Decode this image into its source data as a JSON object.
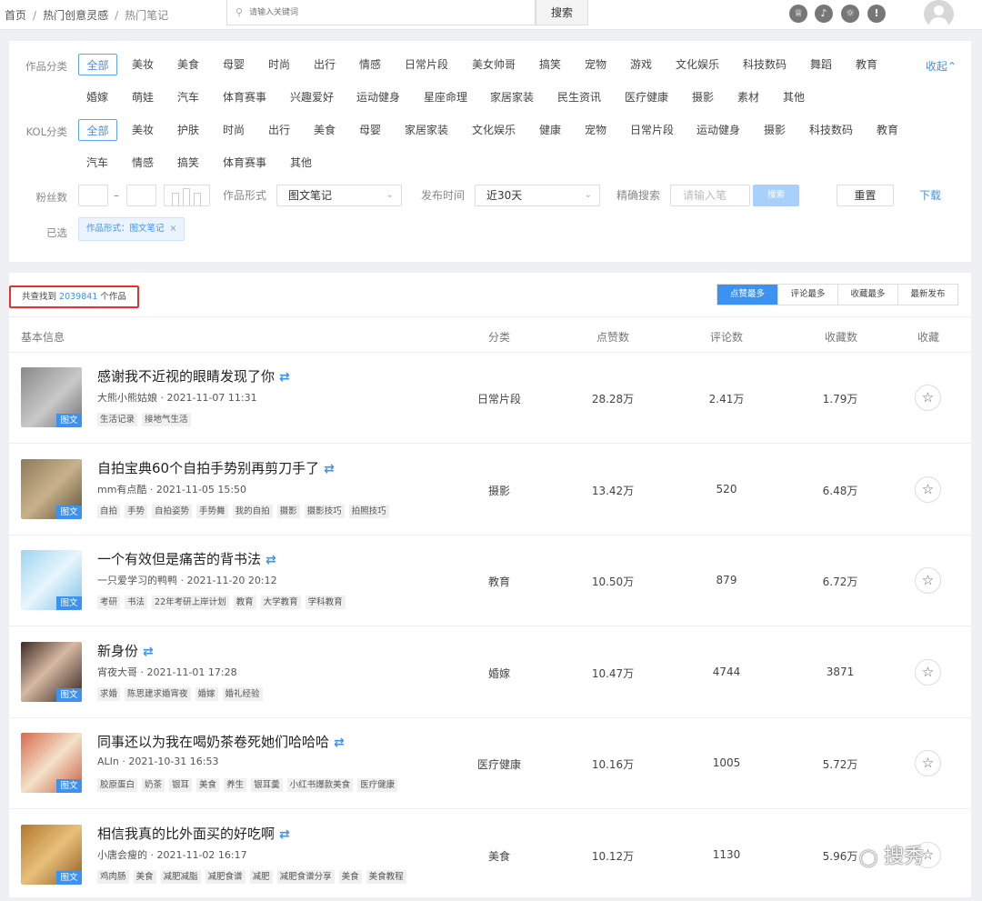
{
  "breadcrumb": {
    "home": "首页",
    "level2": "热门创意灵感",
    "current": "热门笔记"
  },
  "search": {
    "placeholder": "请输入关键词",
    "button": "搜索"
  },
  "filters": {
    "work_category": {
      "label": "作品分类",
      "row1": [
        "全部",
        "美妆",
        "美食",
        "母婴",
        "时尚",
        "出行",
        "情感",
        "日常片段",
        "美女帅哥",
        "搞笑",
        "宠物",
        "游戏",
        "文化娱乐",
        "科技数码",
        "舞蹈",
        "教育"
      ],
      "row2": [
        "婚嫁",
        "萌娃",
        "汽车",
        "体育赛事",
        "兴趣爱好",
        "运动健身",
        "星座命理",
        "家居家装",
        "民生资讯",
        "医疗健康",
        "摄影",
        "素材",
        "其他"
      ],
      "collapse": "收起"
    },
    "kol_category": {
      "label": "KOL分类",
      "row1": [
        "全部",
        "美妆",
        "护肤",
        "时尚",
        "出行",
        "美食",
        "母婴",
        "家居家装",
        "文化娱乐",
        "健康",
        "宠物",
        "日常片段",
        "运动健身",
        "摄影",
        "科技数码",
        "教育"
      ],
      "row2": [
        "汽车",
        "情感",
        "搞笑",
        "体育赛事",
        "其他"
      ]
    },
    "fans_label": "粉丝数",
    "fans_dash": "–",
    "work_form": {
      "label": "作品形式",
      "value": "图文笔记"
    },
    "publish_time": {
      "label": "发布时间",
      "value": "近30天"
    },
    "exact_search": {
      "label": "精确搜索",
      "placeholder": "请输入笔",
      "button": "搜索"
    },
    "reset": "重置",
    "download": "下载",
    "selected": {
      "label": "已选",
      "chip": "作品形式：图文笔记",
      "close": "×"
    }
  },
  "results": {
    "prefix": "共查找到",
    "count": "2039841",
    "suffix": "个作品"
  },
  "sort_tabs": [
    "点赞最多",
    "评论最多",
    "收藏最多",
    "最新发布"
  ],
  "columns": {
    "info": "基本信息",
    "category": "分类",
    "likes": "点赞数",
    "comments": "评论数",
    "favorites": "收藏数",
    "collect": "收藏"
  },
  "thumb_tag": "图文",
  "rows": [
    {
      "title": "感谢我不近视的眼睛发现了你",
      "meta": "大熊小熊姑娘 · 2021-11-07 11:31",
      "tags": [
        "生活记录",
        "接地气生活"
      ],
      "category": "日常片段",
      "likes": "28.28万",
      "comments": "2.41万",
      "favorites": "1.79万"
    },
    {
      "title": "自拍宝典60个自拍手势别再剪刀手了",
      "meta": "mm有点酷 · 2021-11-05 15:50",
      "tags": [
        "自拍",
        "手势",
        "自拍姿势",
        "手势舞",
        "我的自拍",
        "摄影",
        "摄影技巧",
        "拍照技巧"
      ],
      "category": "摄影",
      "likes": "13.42万",
      "comments": "520",
      "favorites": "6.48万"
    },
    {
      "title": "一个有效但是痛苦的背书法",
      "meta": "一只爱学习的鸭鸭 · 2021-11-20 20:12",
      "tags": [
        "考研",
        "书法",
        "22年考研上岸计划",
        "教育",
        "大学教育",
        "学科教育"
      ],
      "category": "教育",
      "likes": "10.50万",
      "comments": "879",
      "favorites": "6.72万"
    },
    {
      "title": "新身份",
      "meta": "宵夜大哥 · 2021-11-01 17:28",
      "tags": [
        "求婚",
        "陈思建求婚宵夜",
        "婚嫁",
        "婚礼经验"
      ],
      "category": "婚嫁",
      "likes": "10.47万",
      "comments": "4744",
      "favorites": "3871"
    },
    {
      "title": "同事还以为我在喝奶茶卷死她们哈哈哈",
      "meta": "ALIn · 2021-10-31 16:53",
      "tags": [
        "胶原蛋白",
        "奶茶",
        "银耳",
        "美食",
        "养生",
        "银耳羹",
        "小红书爆款美食",
        "医疗健康"
      ],
      "category": "医疗健康",
      "likes": "10.16万",
      "comments": "1005",
      "favorites": "5.72万"
    },
    {
      "title": "相信我真的比外面买的好吃啊",
      "meta": "小唐会瘦的 · 2021-11-02 16:17",
      "tags": [
        "鸡肉肠",
        "美食",
        "减肥减脂",
        "减肥食谱",
        "减肥",
        "减肥食谱分享",
        "美食",
        "美食教程"
      ],
      "category": "美食",
      "likes": "10.12万",
      "comments": "1130",
      "favorites": "5.96万"
    }
  ],
  "watermark": "搜秀"
}
